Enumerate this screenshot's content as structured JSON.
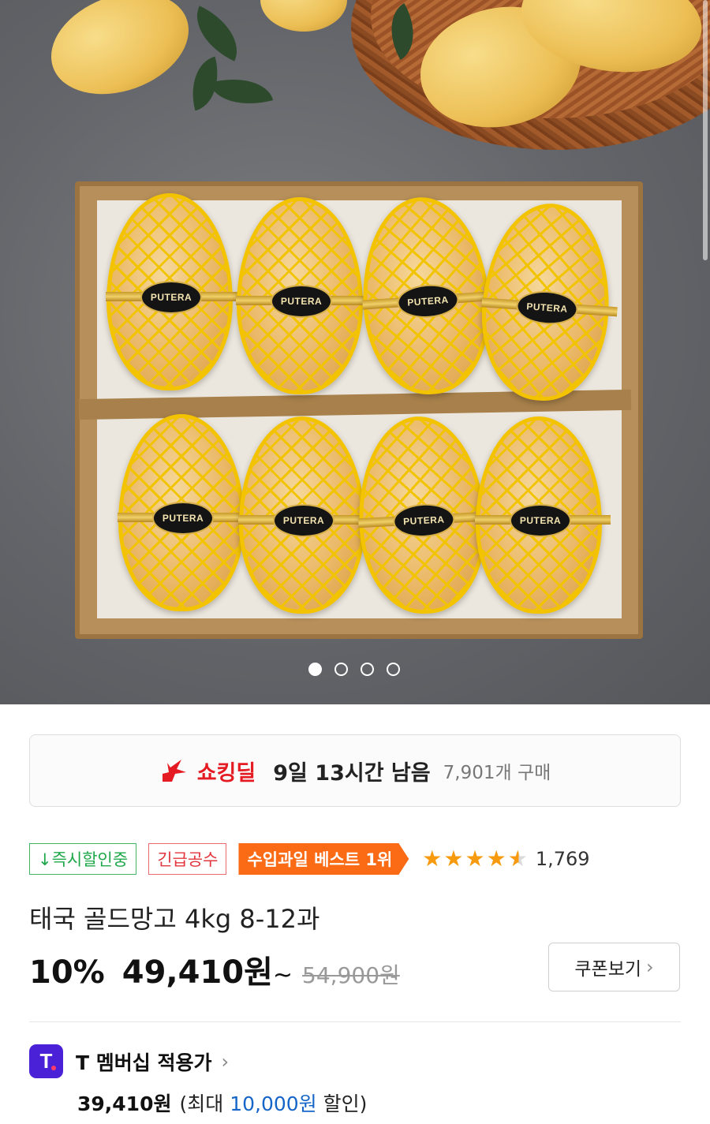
{
  "hero": {
    "brand_label": "PUTERA",
    "carousel": {
      "total": 4,
      "active_index": 0
    }
  },
  "deal": {
    "icon": "shocking-deal-bolt-icon",
    "label": "쇼킹딜",
    "time_left": "9일 13시간 남음",
    "purchase_count": "7,901개 구매",
    "accent_color": "#e51b23"
  },
  "badges": [
    {
      "label": "↓즉시할인중",
      "color": "#1fa84a"
    },
    {
      "label": "긴급공수",
      "color": "#e2353e"
    },
    {
      "label": "수입과일 베스트 1위",
      "color": "#fb6a14"
    }
  ],
  "rating": {
    "stars": 4.5,
    "max": 5,
    "review_count": "1,769"
  },
  "product": {
    "title": "태국 골드망고 4kg 8-12과",
    "discount": "10%",
    "sale_price": "49,410원",
    "price_suffix": "~",
    "original_price": "54,900원"
  },
  "coupon": {
    "label": "쿠폰보기",
    "icon": "chevron-right-icon"
  },
  "membership": {
    "logo_text": "T",
    "label": "T 멤버십 적용가",
    "price": "39,410원",
    "note_prefix": "(최대 ",
    "max_discount": "10,000원",
    "note_suffix": " 할인)",
    "accent_color": "#4a21d6"
  }
}
